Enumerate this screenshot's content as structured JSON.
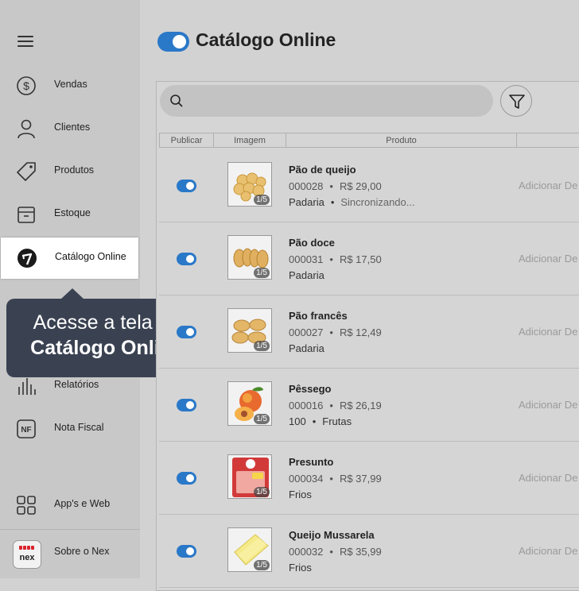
{
  "sidebar": {
    "items": [
      {
        "label": "Vendas",
        "icon": "dollar-circle-icon"
      },
      {
        "label": "Clientes",
        "icon": "user-icon"
      },
      {
        "label": "Produtos",
        "icon": "tag-icon"
      },
      {
        "label": "Estoque",
        "icon": "box-icon"
      },
      {
        "label": "Catálogo Online",
        "icon": "catalog-online-icon"
      },
      {
        "label": "Relatórios",
        "icon": "bar-chart-icon"
      },
      {
        "label": "Nota Fiscal",
        "icon": "nf-icon"
      },
      {
        "label": "App's e Web",
        "icon": "apps-grid-icon"
      },
      {
        "label": "Sobre o Nex",
        "icon": "nex-logo"
      }
    ],
    "nf_icon_text": "NF",
    "logo_text": "nex"
  },
  "tooltip": {
    "line1": "Acesse a tela de",
    "line2": "Catálogo Online"
  },
  "header": {
    "title": "Catálogo Online"
  },
  "search": {
    "placeholder": ""
  },
  "table": {
    "columns": [
      "Publicar",
      "Imagem",
      "Produto"
    ],
    "action_label": "Adicionar De",
    "rows": [
      {
        "name": "Pão de queijo",
        "code": "000028",
        "price": "R$ 29,00",
        "category": "Padaria",
        "extra": "Sincronizando...",
        "image_count": "1/5",
        "image": "pao-de-queijo"
      },
      {
        "name": "Pão doce",
        "code": "000031",
        "price": "R$ 17,50",
        "category": "Padaria",
        "extra": "",
        "image_count": "1/5",
        "image": "pao-doce"
      },
      {
        "name": "Pão francês",
        "code": "000027",
        "price": "R$ 12,49",
        "category": "Padaria",
        "extra": "",
        "image_count": "1/5",
        "image": "pao-frances"
      },
      {
        "name": "Pêssego",
        "code": "000016",
        "price": "R$ 26,19",
        "category": "100",
        "extra": "Frutas",
        "image_count": "1/5",
        "image": "pessego"
      },
      {
        "name": "Presunto",
        "code": "000034",
        "price": "R$ 37,99",
        "category": "Frios",
        "extra": "",
        "image_count": "1/5",
        "image": "presunto"
      },
      {
        "name": "Queijo Mussarela",
        "code": "000032",
        "price": "R$ 35,99",
        "category": "Frios",
        "extra": "",
        "image_count": "1/5",
        "image": "queijo-mussarela"
      }
    ]
  },
  "colors": {
    "accent": "#2a78c8",
    "tooltip_bg": "#3a4252",
    "logo_red": "#d9232e"
  }
}
